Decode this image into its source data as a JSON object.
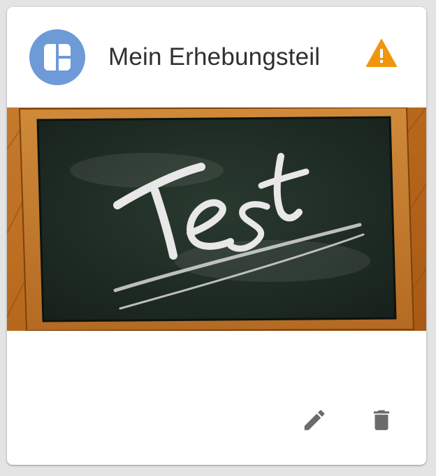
{
  "card": {
    "title": "Mein Erhebungsteil",
    "avatar_icon": "dashboard-layout-icon",
    "status_icon": "warning-icon",
    "media": {
      "subject": "chalkboard",
      "chalk_text": "Test"
    },
    "actions": [
      {
        "icon": "pencil-icon"
      },
      {
        "icon": "trash-icon"
      }
    ]
  },
  "colors": {
    "avatar_bg": "#6f9ad8",
    "warning": "#f0960e",
    "action_icon": "#6b6b6b",
    "title_text": "#303030",
    "chalkboard": "#1d2b22",
    "frame_wood": "#b96a1e"
  }
}
